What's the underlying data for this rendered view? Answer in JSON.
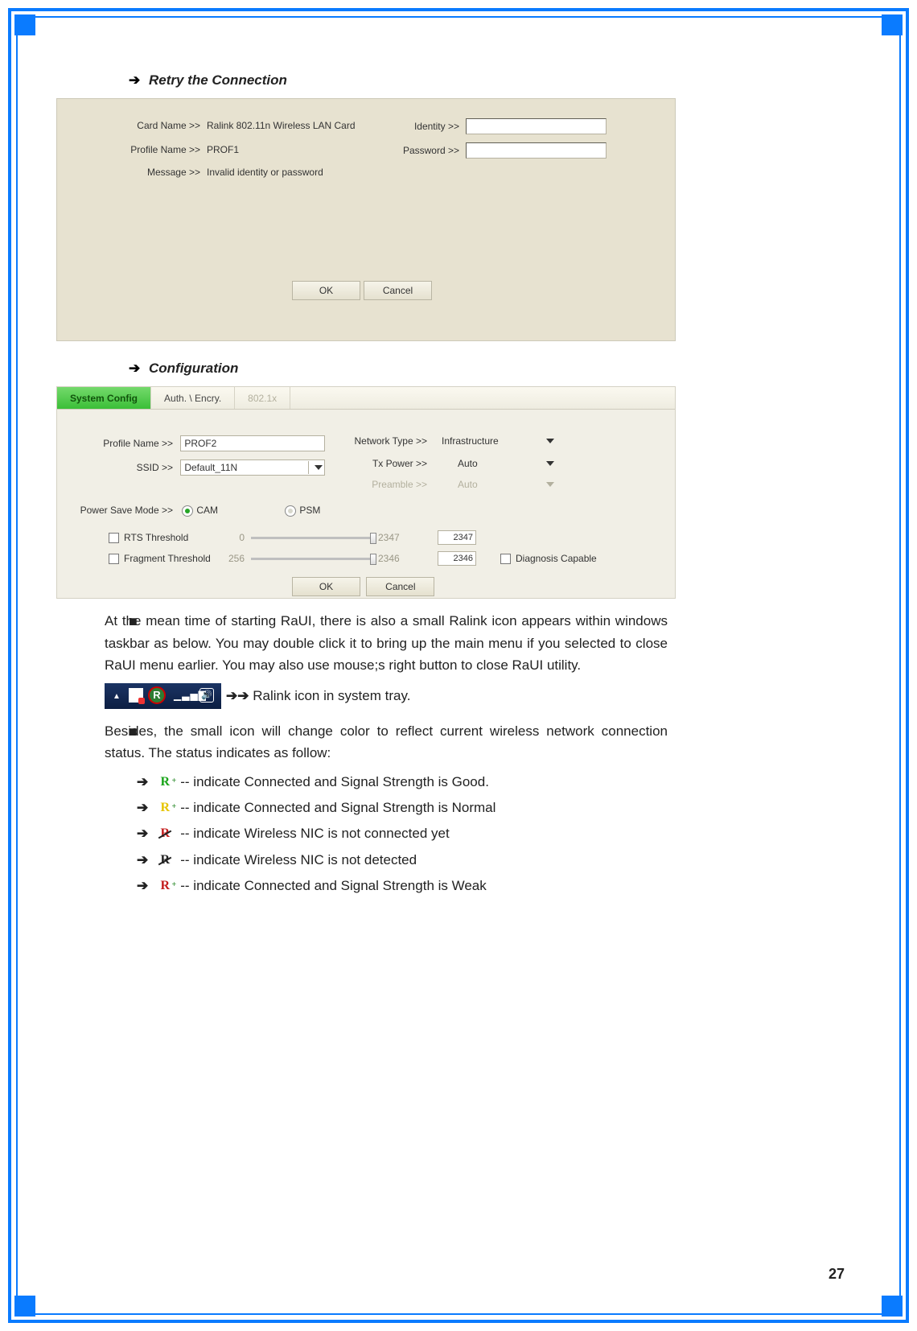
{
  "heading1": "Retry the Connection",
  "heading2": "Configuration",
  "shot1": {
    "card_name_label": "Card Name >>",
    "card_name_value": "Ralink 802.11n Wireless LAN Card",
    "profile_name_label": "Profile Name >>",
    "profile_name_value": "PROF1",
    "message_label": "Message >>",
    "message_value": "Invalid identity or password",
    "identity_label": "Identity >>",
    "password_label": "Password >>",
    "ok": "OK",
    "cancel": "Cancel"
  },
  "shot2": {
    "tabs": {
      "t1": "System Config",
      "t2": "Auth. \\ Encry.",
      "t3": "802.1x"
    },
    "profile_name_label": "Profile Name >>",
    "profile_name_value": "PROF2",
    "ssid_label": "SSID >>",
    "ssid_value": "Default_11N",
    "network_type_label": "Network Type >>",
    "network_type_value": "Infrastructure",
    "tx_power_label": "Tx Power >>",
    "tx_power_value": "Auto",
    "preamble_label": "Preamble >>",
    "preamble_value": "Auto",
    "psm_label": "Power Save Mode >>",
    "cam": "CAM",
    "psm": "PSM",
    "rts_label": "RTS Threshold",
    "rts_min": "0",
    "rts_max": "2347",
    "rts_val": "2347",
    "frag_label": "Fragment Threshold",
    "frag_min": "256",
    "frag_max": "2346",
    "frag_val": "2346",
    "diag_label": "Diagnosis Capable",
    "ok": "OK",
    "cancel": "Cancel"
  },
  "para1": "At the mean time of starting RaUI, there is also a small Ralink icon appears within windows taskbar as below. You may double click it to bring up the main menu if you selected to close RaUI menu earlier. You may also use mouse;s right button to close RaUI utility.",
  "systray_caption": " Ralink icon in system tray.",
  "para2": "Besides, the small icon will change color to reflect current wireless network connection status. The status indicates as follow:",
  "status": {
    "good": " -- indicate Connected and Signal Strength is Good.",
    "normal": " -- indicate Connected and Signal Strength is Normal",
    "notconn": " -- indicate Wireless NIC is not connected yet",
    "notdet": " -- indicate Wireless NIC is not detected",
    "weak": " -- indicate Connected and Signal Strength is Weak"
  },
  "page_number": "27"
}
